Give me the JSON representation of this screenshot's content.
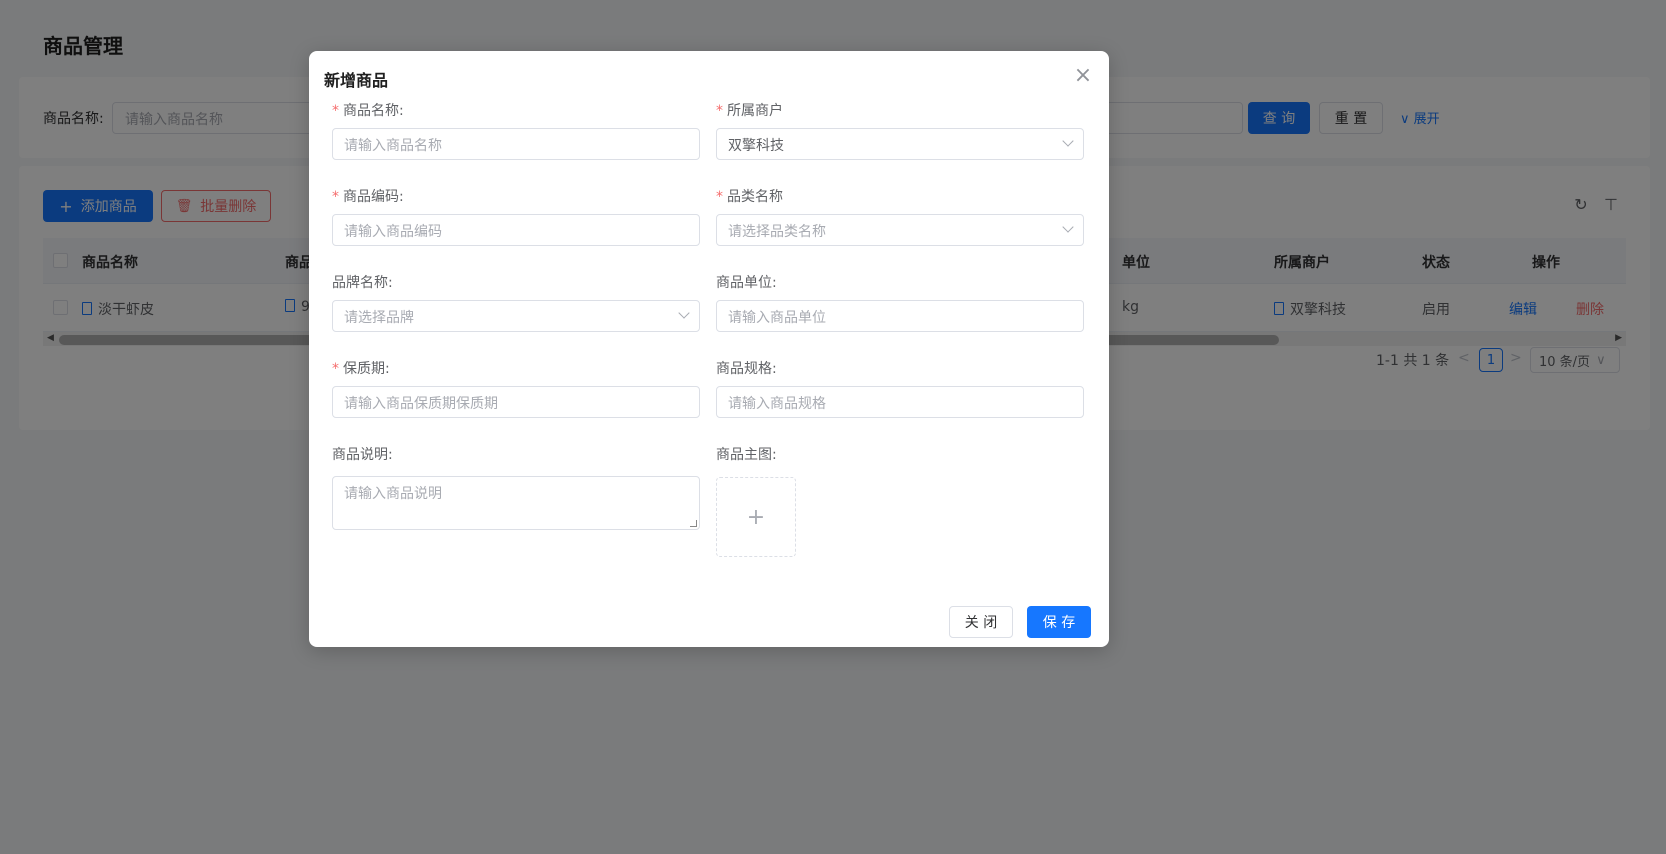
{
  "page": {
    "title": "商品管理"
  },
  "search": {
    "name_label": "商品名称:",
    "name_placeholder": "请输入商品名称",
    "query_label": "查 询",
    "reset_label": "重 置",
    "expand_label": "展开"
  },
  "toolbar": {
    "add_label": "添加商品",
    "batch_delete_label": "批量删除"
  },
  "table": {
    "headers": [
      "商品名称",
      "商品",
      "单位",
      "所属商户",
      "状态",
      "操作"
    ],
    "rows": [
      {
        "name": "淡干虾皮",
        "code_prefix": "9",
        "unit": "kg",
        "merchant": "双擎科技",
        "status": "启用",
        "edit": "编辑",
        "delete": "删除"
      }
    ]
  },
  "pagination": {
    "total": "1-1 共 1 条",
    "prev": "<",
    "current": "1",
    "next": ">",
    "page_size": "10 条/页"
  },
  "dialog": {
    "title": "新增商品",
    "close_icon": "×",
    "fields": {
      "name": {
        "label": "商品名称:",
        "placeholder": "请输入商品名称",
        "required": true
      },
      "merchant": {
        "label": "所属商户",
        "value": "双擎科技",
        "required": true
      },
      "code": {
        "label": "商品编码:",
        "placeholder": "请输入商品编码",
        "required": true
      },
      "category": {
        "label": "品类名称",
        "placeholder": "请选择品类名称",
        "required": true
      },
      "brand": {
        "label": "品牌名称:",
        "placeholder": "请选择品牌",
        "required": false
      },
      "unit": {
        "label": "商品单位:",
        "placeholder": "请输入商品单位",
        "required": false
      },
      "shelf_life": {
        "label": "保质期:",
        "placeholder": "请输入商品保质期保质期",
        "required": true
      },
      "spec": {
        "label": "商品规格:",
        "placeholder": "请输入商品规格",
        "required": false
      },
      "description": {
        "label": "商品说明:",
        "placeholder": "请输入商品说明",
        "required": false
      },
      "image": {
        "label": "商品主图:",
        "upload_icon": "+"
      }
    },
    "required_mark": "*",
    "cancel_label": "关 闭",
    "save_label": "保 存"
  },
  "colors": {
    "primary": "#1677ff",
    "danger": "#f56c6c"
  }
}
